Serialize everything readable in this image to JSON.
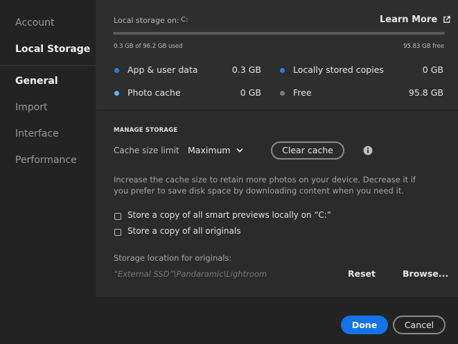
{
  "sidebar": {
    "items": [
      {
        "label": "Account"
      },
      {
        "label": "Local Storage"
      },
      {
        "label": "General"
      },
      {
        "label": "Import"
      },
      {
        "label": "Interface"
      },
      {
        "label": "Performance"
      }
    ]
  },
  "storage": {
    "label": "Local storage on:",
    "drive": "C:",
    "learn_more": "Learn More",
    "used_text": "0.3 GB of 96.2 GB used",
    "free_text": "95.83 GB free",
    "used_fraction": 0.003,
    "stats": [
      {
        "label": "App & user data",
        "value": "0.3 GB",
        "color": "#2d7ddb"
      },
      {
        "label": "Photo cache",
        "value": "0 GB",
        "color": "#6fb3f0"
      },
      {
        "label": "Locally stored copies",
        "value": "0 GB",
        "color": "#2d7ddb"
      },
      {
        "label": "Free",
        "value": "95.8 GB",
        "color": "#7a7a7a"
      }
    ]
  },
  "manage": {
    "title": "MANAGE STORAGE",
    "cache_label": "Cache size limit",
    "cache_value": "Maximum",
    "clear_cache": "Clear cache",
    "description": "Increase the cache size to retain more photos on your device. Decrease it if you prefer to save disk space by downloading content when you need it.",
    "checkbox_previews": "Store a copy of all smart previews locally on “C:”",
    "checkbox_originals": "Store a copy of all originals",
    "location_label": "Storage location for originals:",
    "location_path": "“External SSD”\\Pandaramic\\Lightroom",
    "reset": "Reset",
    "browse": "Browse..."
  },
  "footer": {
    "done": "Done",
    "cancel": "Cancel"
  },
  "colors": {
    "accent": "#1473e6"
  }
}
